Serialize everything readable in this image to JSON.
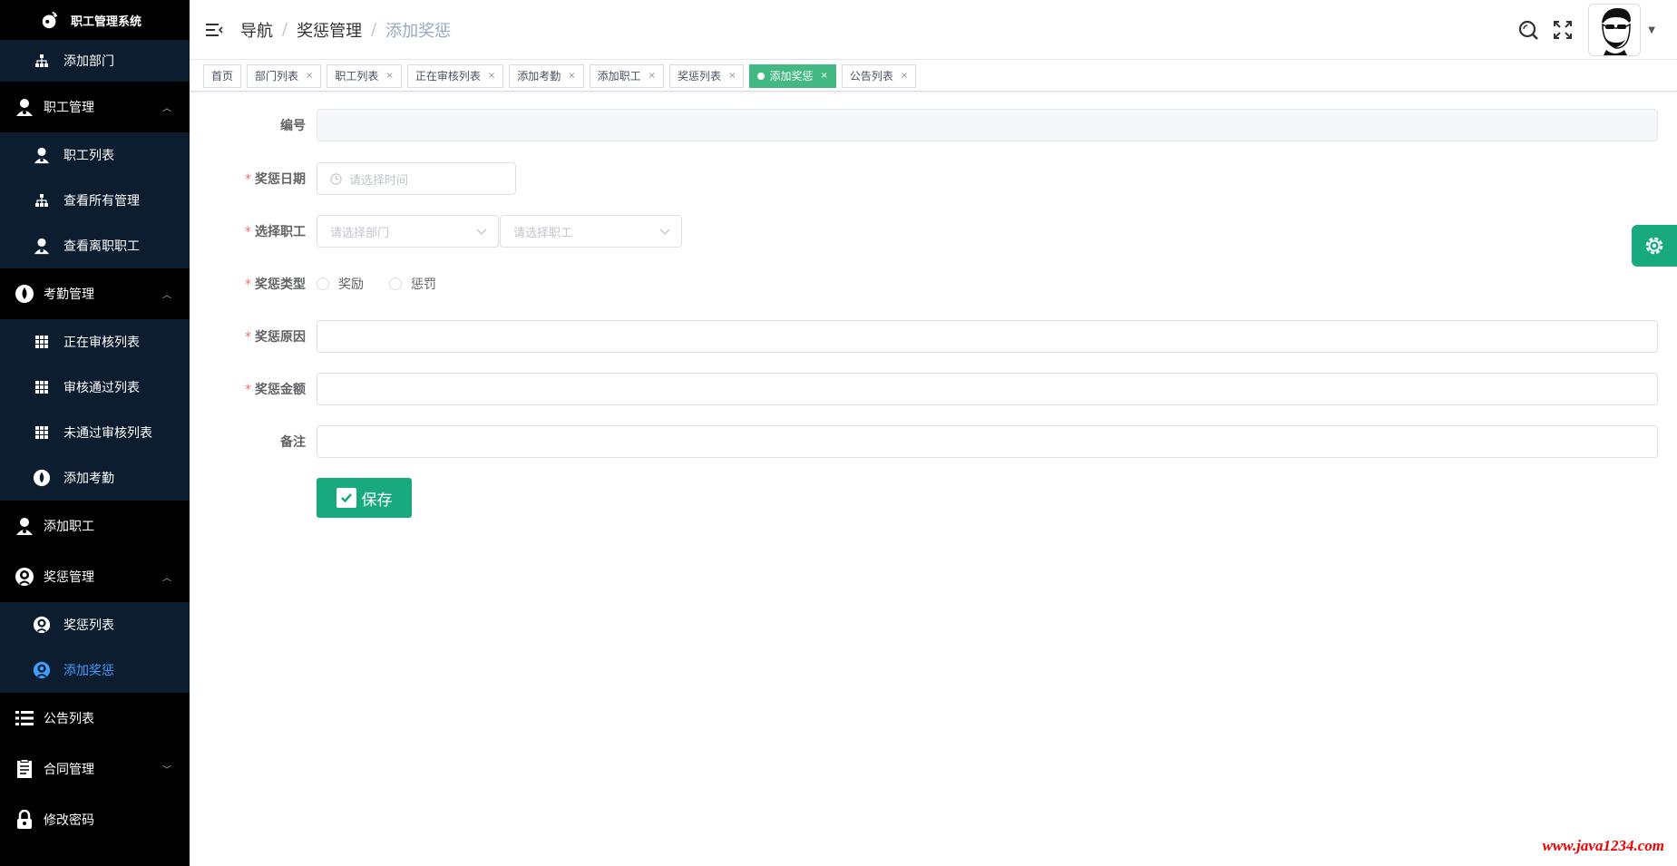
{
  "app": {
    "title": "职工管理系统"
  },
  "sidebar": {
    "items": [
      {
        "label": "添加部门",
        "level": "sub",
        "icon": "org-chart-icon"
      },
      {
        "label": "职工管理",
        "level": "top",
        "icon": "user-icon",
        "arrow": "up"
      },
      {
        "label": "职工列表",
        "level": "sub",
        "icon": "user-icon"
      },
      {
        "label": "查看所有管理",
        "level": "sub",
        "icon": "org-chart-icon"
      },
      {
        "label": "查看离职职工",
        "level": "sub",
        "icon": "user-icon"
      },
      {
        "label": "考勤管理",
        "level": "top",
        "icon": "drop-icon",
        "arrow": "up"
      },
      {
        "label": "正在审核列表",
        "level": "sub",
        "icon": "grid-icon"
      },
      {
        "label": "审核通过列表",
        "level": "sub",
        "icon": "grid-icon"
      },
      {
        "label": "未通过审核列表",
        "level": "sub",
        "icon": "grid-icon"
      },
      {
        "label": "添加考勤",
        "level": "sub",
        "icon": "drop-icon"
      },
      {
        "label": "添加职工",
        "level": "top",
        "icon": "user-icon"
      },
      {
        "label": "奖惩管理",
        "level": "top",
        "icon": "reward-icon",
        "arrow": "up"
      },
      {
        "label": "奖惩列表",
        "level": "sub",
        "icon": "reward-icon"
      },
      {
        "label": "添加奖惩",
        "level": "sub",
        "icon": "reward-icon",
        "active": true
      },
      {
        "label": "公告列表",
        "level": "top",
        "icon": "list-icon"
      },
      {
        "label": "合同管理",
        "level": "top",
        "icon": "document-icon",
        "arrow": "down"
      },
      {
        "label": "修改密码",
        "level": "top",
        "icon": "lock-icon"
      }
    ]
  },
  "breadcrumb": {
    "items": [
      "导航",
      "奖惩管理",
      "添加奖惩"
    ],
    "separator": "/"
  },
  "tags": [
    {
      "label": "首页",
      "closable": false
    },
    {
      "label": "部门列表",
      "closable": true
    },
    {
      "label": "职工列表",
      "closable": true
    },
    {
      "label": "正在审核列表",
      "closable": true
    },
    {
      "label": "添加考勤",
      "closable": true
    },
    {
      "label": "添加职工",
      "closable": true
    },
    {
      "label": "奖惩列表",
      "closable": true
    },
    {
      "label": "添加奖惩",
      "closable": true,
      "active": true
    },
    {
      "label": "公告列表",
      "closable": true
    }
  ],
  "form": {
    "id": {
      "label": "编号",
      "value": ""
    },
    "date": {
      "label": "奖惩日期",
      "placeholder": "请选择时间",
      "required": true
    },
    "employee": {
      "label": "选择职工",
      "dept_placeholder": "请选择部门",
      "emp_placeholder": "请选择职工",
      "required": true
    },
    "type": {
      "label": "奖惩类型",
      "options": [
        "奖励",
        "惩罚"
      ],
      "required": true
    },
    "reason": {
      "label": "奖惩原因",
      "value": "",
      "required": true
    },
    "amount": {
      "label": "奖惩金额",
      "value": "",
      "required": true
    },
    "remark": {
      "label": "备注",
      "value": ""
    },
    "save_label": "保存",
    "required_mark": "*"
  },
  "watermark": "www.java1234.com",
  "colors": {
    "sidebar_bg": "#000000",
    "submenu_bg": "#0d1d30",
    "active_text": "#409eff",
    "accent": "#18a97f",
    "active_tag": "#42b983",
    "required": "#f56c6c"
  }
}
